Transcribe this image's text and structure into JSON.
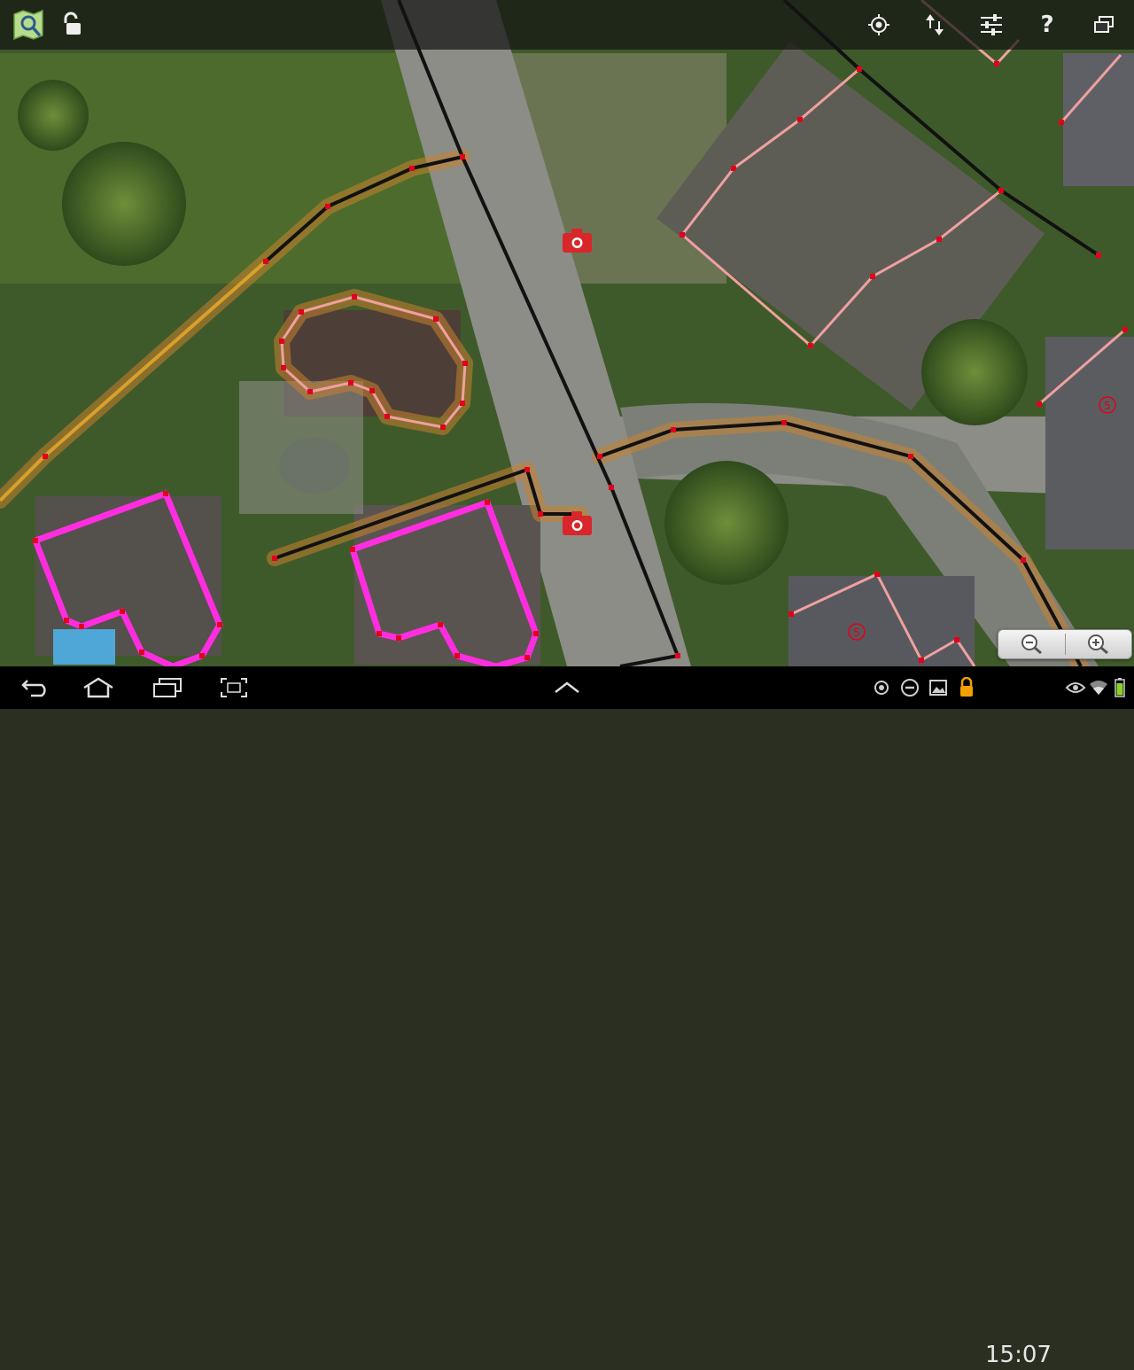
{
  "app": {
    "toolbar": {
      "logo_icon": "map-logo-icon",
      "lock_icon": "unlocked-padlock-icon",
      "actions": [
        {
          "name": "gps-locate-icon"
        },
        {
          "name": "upload-download-icon"
        },
        {
          "name": "settings-sliders-icon"
        },
        {
          "name": "help-icon",
          "label": "?"
        },
        {
          "name": "window-menu-icon"
        }
      ]
    },
    "map": {
      "photo_markers": [
        "camera-icon",
        "camera-icon"
      ],
      "house_numbers": [
        "5",
        "5"
      ]
    },
    "zoom": {
      "out_icon": "zoom-out-icon",
      "in_icon": "zoom-in-icon"
    }
  },
  "system_bar": {
    "time": "15:07",
    "nav_icons": [
      "back-icon",
      "home-icon",
      "recent-apps-icon",
      "screenshot-icon",
      "up-chevron-icon"
    ],
    "status_icons": [
      "gps-icon",
      "do-not-disturb-icon",
      "gallery-icon",
      "lock-icon",
      "eye-icon",
      "wifi-icon",
      "battery-icon"
    ]
  },
  "colors": {
    "selected_way": "#ff2de0",
    "building_outline": "#f0a0a0",
    "road": "#111111",
    "node": "#e3001b",
    "highlight_halo": "#c8822e",
    "footpath": "#d9a02a"
  }
}
